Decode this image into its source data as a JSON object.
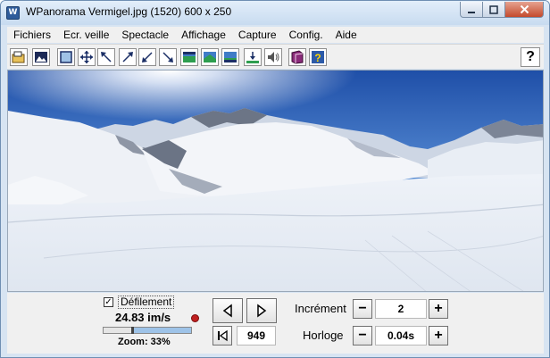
{
  "window": {
    "title": "WPanorama  Vermigel.jpg  (1520) 600 x 250"
  },
  "menu": {
    "items": [
      {
        "label": "Fichiers"
      },
      {
        "label": "Ecr. veille"
      },
      {
        "label": "Spectacle"
      },
      {
        "label": "Affichage"
      },
      {
        "label": "Capture"
      },
      {
        "label": "Config."
      },
      {
        "label": "Aide"
      }
    ]
  },
  "toolbar": {
    "help_label": "?"
  },
  "controls": {
    "scroll_label": "Défilement",
    "scroll_checked": "✓",
    "rate": "24.83 im/s",
    "zoom_label": "Zoom: 33%",
    "zoom_fraction": 0.33,
    "frame": "949",
    "increment_label": "Incrément",
    "increment_value": "2",
    "clock_label": "Horloge",
    "clock_value": "0.04s",
    "minus": "−",
    "plus": "+"
  },
  "colors": {
    "sky": "#2d63c0",
    "snow": "#f2f4f8",
    "titlebar": "#c8dbf0",
    "close": "#c44a2c"
  }
}
